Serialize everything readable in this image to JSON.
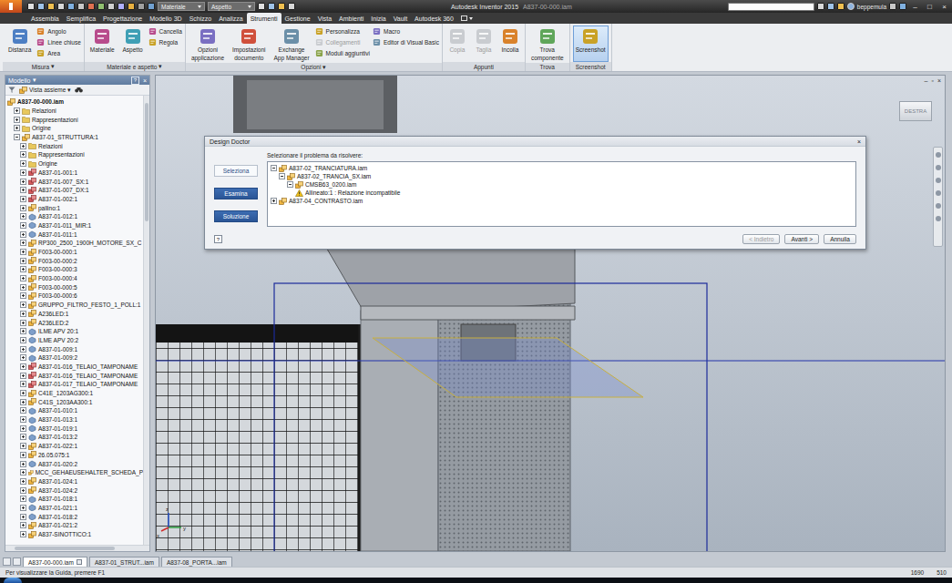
{
  "window": {
    "app": "Autodesk Inventor 2015",
    "document": "A837-00-000.iam",
    "controls": [
      "–",
      "□",
      "×"
    ]
  },
  "quick_access": {
    "dropdowns": [
      {
        "label": "Materiale"
      },
      {
        "label": "Aspetto"
      }
    ]
  },
  "account": {
    "user": "beppemula"
  },
  "ribbon_tabs": [
    {
      "label": "Assembla",
      "selected": false
    },
    {
      "label": "Semplifica",
      "selected": false
    },
    {
      "label": "Progettazione",
      "selected": false
    },
    {
      "label": "Modello 3D",
      "selected": false
    },
    {
      "label": "Schizzo",
      "selected": false
    },
    {
      "label": "Analizza",
      "selected": false
    },
    {
      "label": "Strumenti",
      "selected": true
    },
    {
      "label": "Gestione",
      "selected": false
    },
    {
      "label": "Vista",
      "selected": false
    },
    {
      "label": "Ambienti",
      "selected": false
    },
    {
      "label": "Inizia",
      "selected": false
    },
    {
      "label": "Vault",
      "selected": false
    },
    {
      "label": "Autodesk 360",
      "selected": false
    }
  ],
  "ribbon_groups": [
    {
      "label": "Misura",
      "arrow": "▾",
      "controls": [
        {
          "kind": "large",
          "lines": [
            "Distanza"
          ],
          "disabled": false,
          "selected": false
        },
        {
          "kind": "stack",
          "items": [
            {
              "label": "Angolo",
              "disabled": false
            },
            {
              "label": "Linee chiuse",
              "disabled": false
            },
            {
              "label": "Area",
              "disabled": false
            }
          ]
        }
      ]
    },
    {
      "label": "Materiale e aspetto",
      "arrow": "▾",
      "controls": [
        {
          "kind": "large",
          "lines": [
            "Materiale"
          ],
          "disabled": false,
          "selected": false
        },
        {
          "kind": "large",
          "lines": [
            "Aspetto"
          ],
          "disabled": false,
          "selected": false
        },
        {
          "kind": "stack",
          "items": [
            {
              "label": "Cancella",
              "disabled": false
            },
            {
              "label": "Regola",
              "disabled": false
            }
          ]
        }
      ]
    },
    {
      "label": "Opzioni",
      "arrow": "▾",
      "controls": [
        {
          "kind": "large",
          "lines": [
            "Opzioni",
            "applicazione"
          ],
          "disabled": false,
          "selected": false
        },
        {
          "kind": "large",
          "lines": [
            "Impostazioni",
            "documento"
          ],
          "disabled": false,
          "selected": false
        },
        {
          "kind": "large",
          "lines": [
            "Exchange",
            "App Manager"
          ],
          "disabled": false,
          "selected": false
        },
        {
          "kind": "stack",
          "items": [
            {
              "label": "Personalizza",
              "disabled": false
            },
            {
              "label": "Collegamenti",
              "disabled": true
            },
            {
              "label": "Moduli aggiuntivi",
              "disabled": false
            }
          ]
        },
        {
          "kind": "stack",
          "items": [
            {
              "label": "Macro",
              "disabled": false
            },
            {
              "label": "Editor di Visual Basic",
              "disabled": false
            }
          ]
        }
      ]
    },
    {
      "label": "Appunti",
      "controls": [
        {
          "kind": "large",
          "lines": [
            "Copia"
          ],
          "disabled": true,
          "selected": false
        },
        {
          "kind": "large",
          "lines": [
            "Taglia"
          ],
          "disabled": true,
          "selected": false
        },
        {
          "kind": "large",
          "lines": [
            "Incolla"
          ],
          "disabled": false,
          "selected": false
        }
      ]
    },
    {
      "label": "Trova",
      "controls": [
        {
          "kind": "large",
          "lines": [
            "Trova",
            "componente"
          ],
          "disabled": false,
          "selected": false
        }
      ]
    },
    {
      "label": "Screenshot",
      "controls": [
        {
          "kind": "large",
          "lines": [
            "Screenshot"
          ],
          "disabled": false,
          "selected": true
        }
      ]
    }
  ],
  "browser": {
    "title": "Modello",
    "title_arrow": "▾",
    "help": "?",
    "close": "×",
    "view": "Vista assieme",
    "view_arrow": "▾",
    "tree": [
      {
        "label": "A837-00-000.iam",
        "depth": 0,
        "kind": "assembly",
        "expandable": false,
        "expanded": false
      },
      {
        "label": "Relazioni",
        "depth": 1,
        "kind": "folder",
        "expandable": true,
        "expanded": false
      },
      {
        "label": "Rappresentazioni",
        "depth": 1,
        "kind": "folder",
        "expandable": true,
        "expanded": false
      },
      {
        "label": "Origine",
        "depth": 1,
        "kind": "folder",
        "expandable": true,
        "expanded": false
      },
      {
        "label": "A837-01_STRUTTURA:1",
        "depth": 1,
        "kind": "assembly",
        "expandable": true,
        "expanded": true
      },
      {
        "label": "Relazioni",
        "depth": 2,
        "kind": "folder",
        "expandable": true,
        "expanded": false
      },
      {
        "label": "Rappresentazioni",
        "depth": 2,
        "kind": "folder",
        "expandable": true,
        "expanded": false
      },
      {
        "label": "Origine",
        "depth": 2,
        "kind": "folder",
        "expandable": true,
        "expanded": false
      },
      {
        "label": "A837-01-001:1",
        "depth": 2,
        "kind": "frame",
        "expandable": true,
        "expanded": false
      },
      {
        "label": "A837-01-007_SX:1",
        "depth": 2,
        "kind": "frame",
        "expandable": true,
        "expanded": false
      },
      {
        "label": "A837-01-007_DX:1",
        "depth": 2,
        "kind": "frame",
        "expandable": true,
        "expanded": false
      },
      {
        "label": "A837-01-002:1",
        "depth": 2,
        "kind": "frame",
        "expandable": true,
        "expanded": false
      },
      {
        "label": "pallino:1",
        "depth": 2,
        "kind": "assembly",
        "expandable": true,
        "expanded": false
      },
      {
        "label": "A837-01-012:1",
        "depth": 2,
        "kind": "part",
        "expandable": true,
        "expanded": false
      },
      {
        "label": "A837-01-011_MIR:1",
        "depth": 2,
        "kind": "part",
        "expandable": true,
        "expanded": false
      },
      {
        "label": "A837-01-011:1",
        "depth": 2,
        "kind": "part",
        "expandable": true,
        "expanded": false
      },
      {
        "label": "RP300_2500_1900H_MOTORE_SX_C",
        "depth": 2,
        "kind": "assembly",
        "expandable": true,
        "expanded": false
      },
      {
        "label": "F003-00-000:1",
        "depth": 2,
        "kind": "assembly",
        "expandable": true,
        "expanded": false
      },
      {
        "label": "F003-00-000:2",
        "depth": 2,
        "kind": "assembly",
        "expandable": true,
        "expanded": false
      },
      {
        "label": "F003-00-000:3",
        "depth": 2,
        "kind": "assembly",
        "expandable": true,
        "expanded": false
      },
      {
        "label": "F003-00-000:4",
        "depth": 2,
        "kind": "assembly",
        "expandable": true,
        "expanded": false
      },
      {
        "label": "F003-00-000:5",
        "depth": 2,
        "kind": "assembly",
        "expandable": true,
        "expanded": false
      },
      {
        "label": "F003-00-000:6",
        "depth": 2,
        "kind": "assembly",
        "expandable": true,
        "expanded": false
      },
      {
        "label": "GRUPPO_FILTRO_FESTO_1_POLL:1",
        "depth": 2,
        "kind": "assembly",
        "expandable": true,
        "expanded": false
      },
      {
        "label": "A236LED:1",
        "depth": 2,
        "kind": "assembly",
        "expandable": true,
        "expanded": false
      },
      {
        "label": "A236LED:2",
        "depth": 2,
        "kind": "assembly",
        "expandable": true,
        "expanded": false
      },
      {
        "label": "ILME APV 20:1",
        "depth": 2,
        "kind": "part",
        "expandable": true,
        "expanded": false
      },
      {
        "label": "ILME APV 20:2",
        "depth": 2,
        "kind": "part",
        "expandable": true,
        "expanded": false
      },
      {
        "label": "A837-01-009:1",
        "depth": 2,
        "kind": "part",
        "expandable": true,
        "expanded": false
      },
      {
        "label": "A837-01-009:2",
        "depth": 2,
        "kind": "part",
        "expandable": true,
        "expanded": false
      },
      {
        "label": "A837-01-016_TELAIO_TAMPONAME",
        "depth": 2,
        "kind": "frame",
        "expandable": true,
        "expanded": false
      },
      {
        "label": "A837-01-016_TELAIO_TAMPONAME",
        "depth": 2,
        "kind": "frame",
        "expandable": true,
        "expanded": false
      },
      {
        "label": "A837-01-017_TELAIO_TAMPONAME",
        "depth": 2,
        "kind": "frame",
        "expandable": true,
        "expanded": false
      },
      {
        "label": "C41E_1203AG300:1",
        "depth": 2,
        "kind": "assembly",
        "expandable": true,
        "expanded": false
      },
      {
        "label": "C41S_1203AA300:1",
        "depth": 2,
        "kind": "assembly",
        "expandable": true,
        "expanded": false
      },
      {
        "label": "A837-01-010:1",
        "depth": 2,
        "kind": "part",
        "expandable": true,
        "expanded": false
      },
      {
        "label": "A837-01-013:1",
        "depth": 2,
        "kind": "part",
        "expandable": true,
        "expanded": false
      },
      {
        "label": "A837-01-019:1",
        "depth": 2,
        "kind": "part",
        "expandable": true,
        "expanded": false
      },
      {
        "label": "A837-01-013:2",
        "depth": 2,
        "kind": "part",
        "expandable": true,
        "expanded": false
      },
      {
        "label": "A837-01-022:1",
        "depth": 2,
        "kind": "assembly",
        "expandable": true,
        "expanded": false
      },
      {
        "label": "26.05.075:1",
        "depth": 2,
        "kind": "assembly",
        "expandable": true,
        "expanded": false
      },
      {
        "label": "A837-01-020:2",
        "depth": 2,
        "kind": "part",
        "expandable": true,
        "expanded": false
      },
      {
        "label": "MCC_GEHAEUSEHALTER_SCHEDA_P",
        "depth": 2,
        "kind": "assembly",
        "expandable": true,
        "expanded": false
      },
      {
        "label": "A837-01-024:1",
        "depth": 2,
        "kind": "assembly",
        "expandable": true,
        "expanded": false
      },
      {
        "label": "A837-01-024:2",
        "depth": 2,
        "kind": "assembly",
        "expandable": true,
        "expanded": false
      },
      {
        "label": "A837-01-018:1",
        "depth": 2,
        "kind": "part",
        "expandable": true,
        "expanded": false
      },
      {
        "label": "A837-01-021:1",
        "depth": 2,
        "kind": "part",
        "expandable": true,
        "expanded": false
      },
      {
        "label": "A837-01-018:2",
        "depth": 2,
        "kind": "part",
        "expandable": true,
        "expanded": false
      },
      {
        "label": "A837-01-021:2",
        "depth": 2,
        "kind": "assembly",
        "expandable": true,
        "expanded": false
      },
      {
        "label": "A837-SINOTTICO:1",
        "depth": 2,
        "kind": "assembly",
        "expandable": true,
        "expanded": false
      }
    ]
  },
  "viewport": {
    "viewcube": "DESTRA",
    "controls": [
      "–",
      "▫",
      "×"
    ],
    "axes": [
      "z",
      "x",
      "y"
    ]
  },
  "design_doctor": {
    "title": "Design Doctor",
    "close": "×",
    "help": "?",
    "steps": [
      {
        "label": "Seleziona",
        "selected": true
      },
      {
        "label": "Esamina",
        "selected": false
      },
      {
        "label": "Soluzione",
        "selected": false
      }
    ],
    "prompt": "Selezionare il problema da risolvere:",
    "tree": [
      {
        "label": "A837-02_TRANCIATURA.iam",
        "depth": 0,
        "kind": "assembly",
        "expandable": true,
        "expanded": true
      },
      {
        "label": "A837-02_TRANCIA_SX.iam",
        "depth": 1,
        "kind": "assembly",
        "expandable": true,
        "expanded": true
      },
      {
        "label": "CMSB63_0200.iam",
        "depth": 2,
        "kind": "assembly",
        "expandable": true,
        "expanded": true
      },
      {
        "label": "Allineato:1 : Relazione incompatibile",
        "depth": 3,
        "kind": "warning",
        "expandable": false,
        "expanded": false
      },
      {
        "label": "A837-04_CONTRASTO.iam",
        "depth": 0,
        "kind": "assembly",
        "expandable": true,
        "expanded": false
      }
    ],
    "buttons": [
      {
        "label": "< Indietro",
        "disabled": true
      },
      {
        "label": "Avanti >",
        "disabled": false
      },
      {
        "label": "Annulla",
        "disabled": false
      }
    ]
  },
  "document_tabs": [
    {
      "label": "A837-00-000.iam",
      "selected": true,
      "closable": true
    },
    {
      "label": "A837-01_STRUT...iam",
      "selected": false,
      "closable": false
    },
    {
      "label": "A837-08_PORTA...iam",
      "selected": false,
      "closable": false
    }
  ],
  "status_bar": {
    "message": "Per visualizzare la Guida, premere F1",
    "values": [
      "1690",
      "510"
    ]
  }
}
